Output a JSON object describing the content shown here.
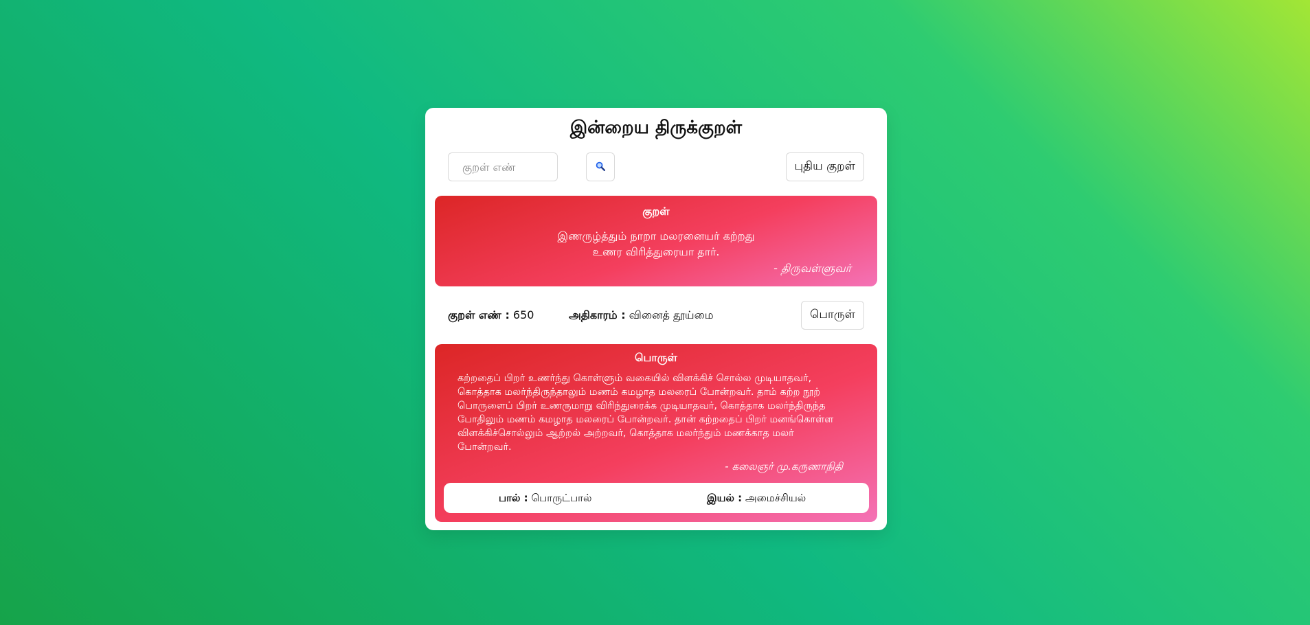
{
  "header": {
    "title": "இன்றைய திருக்குறள்"
  },
  "toolbar": {
    "search_placeholder": "குறள் எண்",
    "search_icon": "magnifier-icon",
    "new_kural_label": "புதிய குறள்"
  },
  "kural": {
    "heading": "குறள்",
    "line1": "இணருழ்த்தும் நாறா மலரனையர் கற்றது",
    "line2": "உணர விரித்துரையா தார்.",
    "author": "- திருவள்ளுவர்"
  },
  "info": {
    "number_label": "குறள் எண் :",
    "number_value": " 650",
    "chapter_label": "அதிகாரம் :",
    "chapter_value": " வினைத் தூய்மை",
    "meaning_button_label": "பொருள்"
  },
  "meaning": {
    "heading": "பொருள்",
    "text": "கற்றதைப் பிறர் உணர்ந்து கொள்ளும் வகையில் விளக்கிச் சொல்ல முடியாதவர், கொத்தாக மலர்ந்திருந்தாலும் மணம் கமழாத மலரைப் போன்றவர். தாம் கற்ற நூற் பொருளைப் பிறர் உணருமாறு விரிந்துரைக்க முடியாதவர், கொத்தாக மலர்ந்திருந்த போதிலும் மணம் கமழாத மலரைப் போன்றவர். தான் கற்றதைப் பிறர் மனங்கொள்ள விளக்கிச்சொல்லும் ஆற்றல் அற்றவர், கொத்தாக மலர்ந்தும் மணக்காத மலர் போன்றவர்.",
    "author": "- கலைஞர் மு.கருணாநிதி",
    "paal_label": "பால் :",
    "paal_value": " பொருட்பால்",
    "iyal_label": "இயல் :",
    "iyal_value": " அமைச்சியல்"
  },
  "colors": {
    "background_gradient": [
      "#a3e635",
      "#10b981",
      "#16a34a"
    ],
    "panel_gradient": [
      "#dc2626",
      "#f43f5e",
      "#f472b6"
    ],
    "icon_blue": "#2563eb"
  }
}
